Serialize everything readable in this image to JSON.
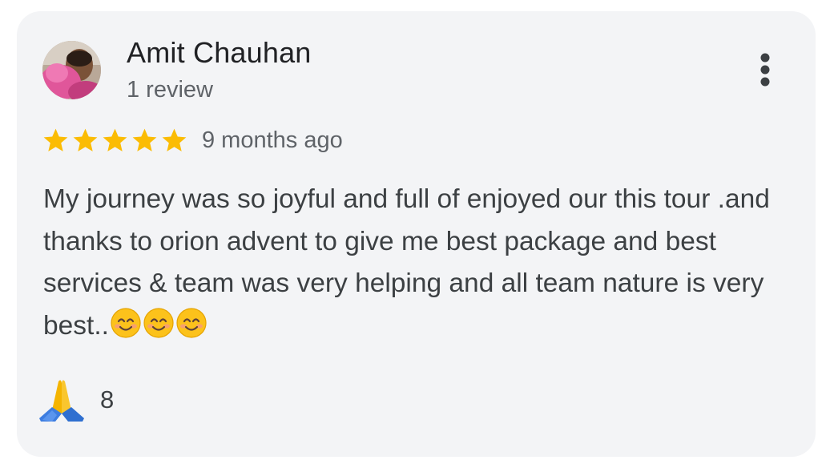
{
  "review": {
    "reviewer_name": "Amit Chauhan",
    "review_count": "1 review",
    "rating": 5,
    "rating_max": 5,
    "time_ago": "9 months ago",
    "text": "My journey was so joyful and full of enjoyed our this tour .and thanks to orion advent to give me best package and best services & team was very helping and all team nature is very best..",
    "trailing_emojis": [
      "smiling-face-icon",
      "smiling-face-icon",
      "smiling-face-icon"
    ],
    "reaction": {
      "icon": "folded-hands-icon",
      "count": "8"
    }
  },
  "colors": {
    "card_background": "#f3f4f6",
    "star": "#fbbc04",
    "name_text": "#202124",
    "secondary_text": "#5f6368",
    "body_text": "#3c4043"
  },
  "icons": {
    "menu": "more-vertical-icon",
    "star": "star-icon",
    "avatar": "reviewer-avatar"
  }
}
